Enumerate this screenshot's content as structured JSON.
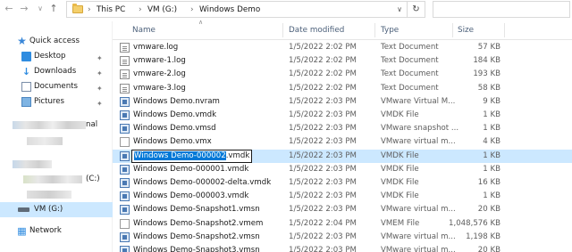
{
  "address": {
    "crumbs": [
      "This PC",
      "VM (G:)",
      "Windows Demo"
    ],
    "refresh_icon": "refresh-icon"
  },
  "nav": {
    "quick_access": "Quick access",
    "items": [
      {
        "label": "Desktop",
        "icon": "desktop-icon"
      },
      {
        "label": "Downloads",
        "icon": "download-icon"
      },
      {
        "label": "Documents",
        "icon": "documents-icon"
      },
      {
        "label": "Pictures",
        "icon": "pictures-icon"
      }
    ],
    "blurred_suffix_1": "nal",
    "blurred_suffix_2": "(C:)",
    "drive": "VM (G:)",
    "network": "Network"
  },
  "columns": {
    "name": "Name",
    "date": "Date modified",
    "type": "Type",
    "size": "Size"
  },
  "rename": {
    "selected_part": "Windows Demo-000002",
    "rest": ".vmdk"
  },
  "files": [
    {
      "name": "vmware.log",
      "date": "1/5/2022 2:02 PM",
      "type": "Text Document",
      "size": "57 KB",
      "icon": "log"
    },
    {
      "name": "vmware-1.log",
      "date": "1/5/2022 2:02 PM",
      "type": "Text Document",
      "size": "184 KB",
      "icon": "log"
    },
    {
      "name": "vmware-2.log",
      "date": "1/5/2022 2:02 PM",
      "type": "Text Document",
      "size": "193 KB",
      "icon": "log"
    },
    {
      "name": "vmware-3.log",
      "date": "1/5/2022 2:02 PM",
      "type": "Text Document",
      "size": "58 KB",
      "icon": "log"
    },
    {
      "name": "Windows Demo.nvram",
      "date": "1/5/2022 2:03 PM",
      "type": "VMware Virtual M...",
      "size": "9 KB",
      "icon": "vm"
    },
    {
      "name": "Windows Demo.vmdk",
      "date": "1/5/2022 2:03 PM",
      "type": "VMDK File",
      "size": "1 KB",
      "icon": "vm"
    },
    {
      "name": "Windows Demo.vmsd",
      "date": "1/5/2022 2:03 PM",
      "type": "VMware snapshot ...",
      "size": "1 KB",
      "icon": "vm"
    },
    {
      "name": "Windows Demo.vmx",
      "date": "1/5/2022 2:03 PM",
      "type": "VMware virtual m...",
      "size": "4 KB",
      "icon": "gen"
    },
    {
      "name": "",
      "date": "1/5/2022 2:03 PM",
      "type": "VMDK File",
      "size": "1 KB",
      "icon": "vm"
    },
    {
      "name": "Windows Demo-000001.vmdk",
      "date": "1/5/2022 2:03 PM",
      "type": "VMDK File",
      "size": "1 KB",
      "icon": "vm"
    },
    {
      "name": "Windows Demo-000002-delta.vmdk",
      "date": "1/5/2022 2:03 PM",
      "type": "VMDK File",
      "size": "16 KB",
      "icon": "vm"
    },
    {
      "name": "Windows Demo-000003.vmdk",
      "date": "1/5/2022 2:03 PM",
      "type": "VMDK File",
      "size": "1 KB",
      "icon": "vm"
    },
    {
      "name": "Windows Demo-Snapshot1.vmsn",
      "date": "1/5/2022 2:03 PM",
      "type": "VMware virtual m...",
      "size": "20 KB",
      "icon": "vm"
    },
    {
      "name": "Windows Demo-Snapshot2.vmem",
      "date": "1/5/2022 2:04 PM",
      "type": "VMEM File",
      "size": "1,048,576 KB",
      "icon": "gen"
    },
    {
      "name": "Windows Demo-Snapshot2.vmsn",
      "date": "1/5/2022 2:03 PM",
      "type": "VMware virtual m...",
      "size": "1,198 KB",
      "icon": "vm"
    },
    {
      "name": "Windows Demo-Snapshot3.vmsn",
      "date": "1/5/2022 2:03 PM",
      "type": "VMware virtual m...",
      "size": "20 KB",
      "icon": "vm"
    }
  ]
}
